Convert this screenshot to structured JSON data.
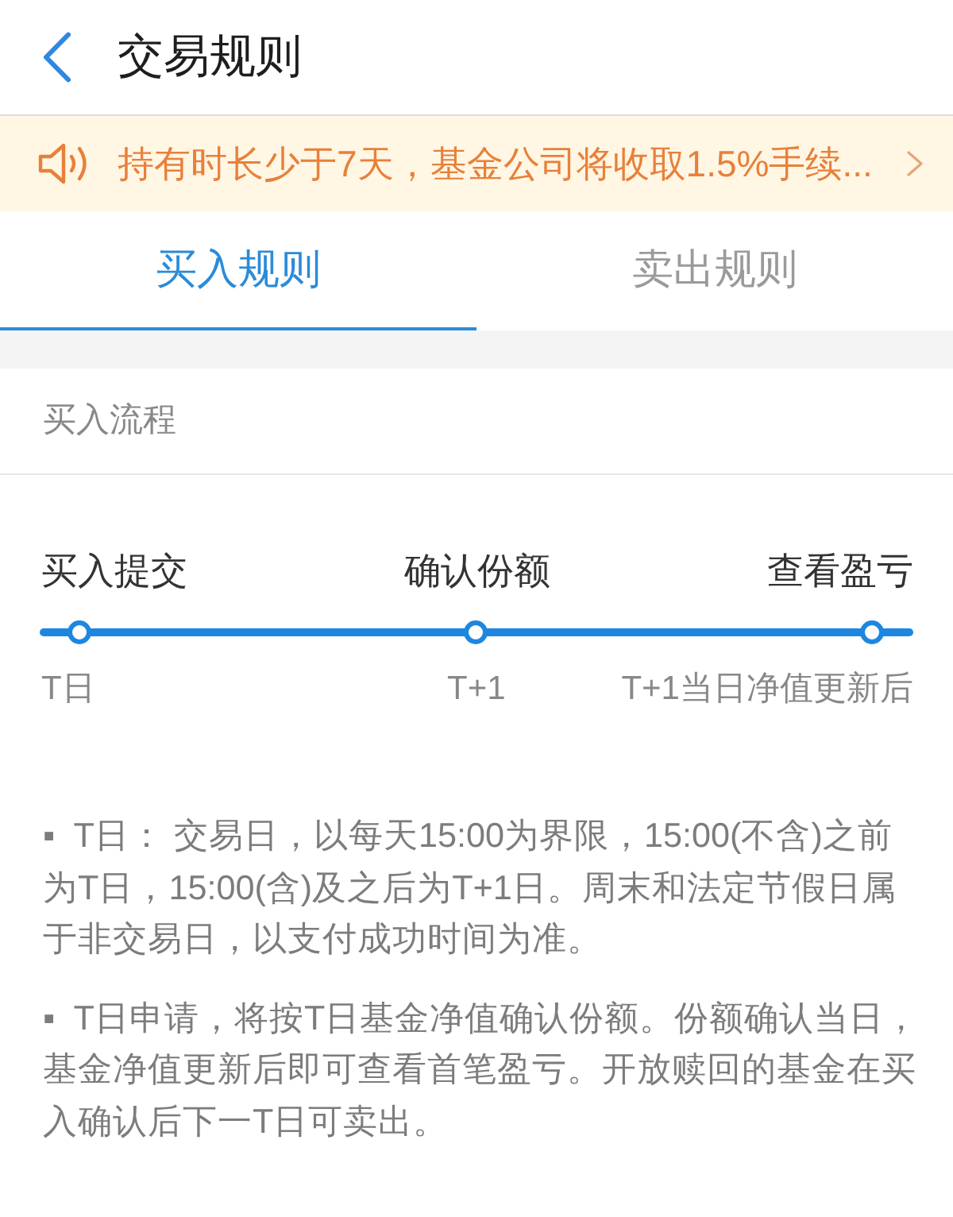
{
  "header": {
    "title": "交易规则"
  },
  "notice": {
    "text": "持有时长少于7天，基金公司将收取1.5%手续..."
  },
  "tabs": [
    {
      "label": "买入规则",
      "selected": true
    },
    {
      "label": "卖出规则",
      "selected": false
    }
  ],
  "section": {
    "title": "买入流程"
  },
  "steps": [
    {
      "label": "买入提交",
      "time": "T日"
    },
    {
      "label": "确认份额",
      "time": "T+1"
    },
    {
      "label": "查看盈亏",
      "time": "T+1当日净值更新后"
    }
  ],
  "rules": [
    "▪  T日： 交易日，以每天15:00为界限，15:00(不含)之前为T日，15:00(含)及之后为T+1日。周末和法定节假日属于非交易日，以支付成功时间为准。",
    "▪  T日申请，将按T日基金净值确认份额。份额确认当日，基金净值更新后即可查看首笔盈亏。开放赎回的基金在买入确认后下一T日可卖出。"
  ]
}
